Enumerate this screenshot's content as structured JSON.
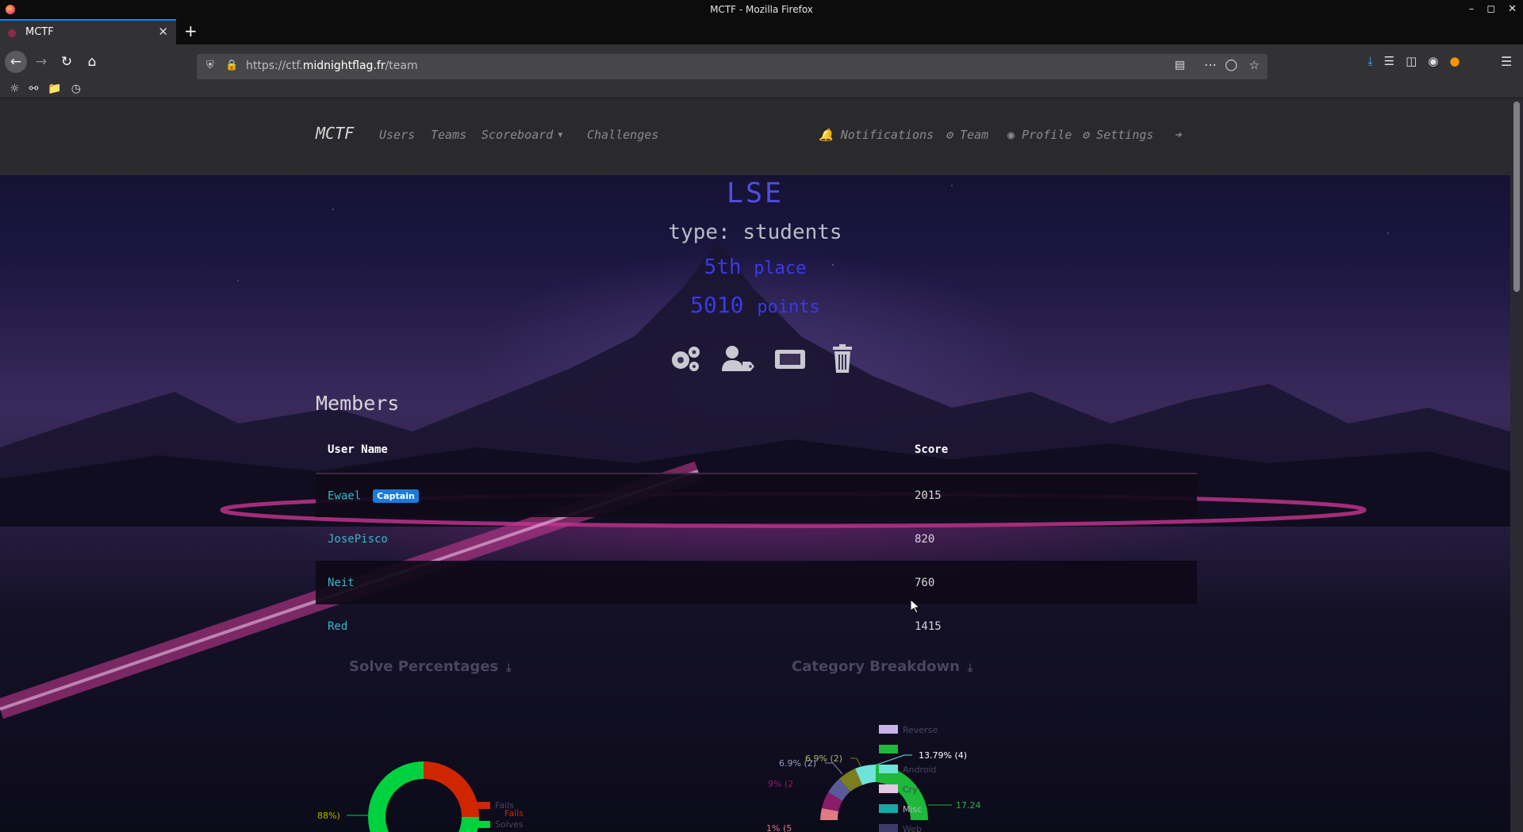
{
  "window": {
    "title": "MCTF - Mozilla Firefox"
  },
  "tab": {
    "title": "MCTF"
  },
  "urlbar": {
    "url_prefix": "https://ctf.",
    "url_host": "midnightflag.fr",
    "url_path": "/team"
  },
  "site_nav": {
    "brand": "MCTF",
    "users": "Users",
    "teams": "Teams",
    "scoreboard": "Scoreboard",
    "challenges": "Challenges",
    "notifications": "Notifications",
    "team": "Team",
    "profile": "Profile",
    "settings": "Settings"
  },
  "team": {
    "name": "LSE",
    "type": "type: students",
    "place_num": "5th",
    "place_word": "place",
    "points_num": "5010",
    "points_word": "points"
  },
  "members": {
    "heading": "Members",
    "columns": [
      "User Name",
      "Score"
    ],
    "captain_badge": "Captain",
    "rows": [
      {
        "name": "Ewael",
        "score": "2015"
      },
      {
        "name": "JosePisco",
        "score": "820"
      },
      {
        "name": "Neit",
        "score": "760"
      },
      {
        "name": "Red",
        "score": "1415"
      }
    ]
  },
  "graphs": {
    "solve_title": "Solve Percentages",
    "category_title": "Category Breakdown"
  },
  "chart_data": [
    {
      "type": "pie",
      "title": "Solve Percentages",
      "labels": [
        "Fails",
        "Solves"
      ],
      "colors": [
        "#cf2600",
        "#00d13f"
      ],
      "visible_annotations": [
        "88%)",
        "Fails"
      ]
    },
    {
      "type": "pie",
      "title": "Category Breakdown",
      "legend": [
        "Reverse",
        "",
        "Android",
        "Cry",
        "Misc",
        "Web"
      ],
      "legend_colors": [
        "#c9b3ea",
        "#1eb83a",
        "#6ee3d8",
        "#e6c7e6",
        "#1aa7a7",
        "#3d3d6a"
      ],
      "visible_annotations": [
        "6.9% (2)",
        "6.9% (2)",
        "13.79% (4)",
        "17.24",
        "9% (2",
        "1% (5"
      ]
    }
  ]
}
